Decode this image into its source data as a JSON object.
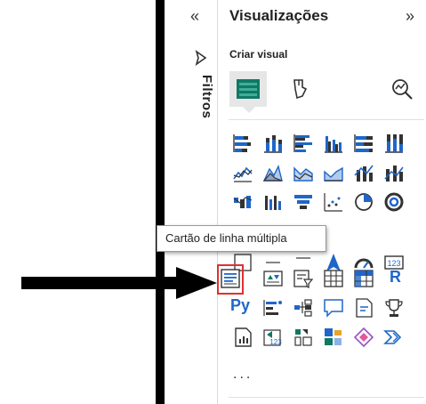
{
  "filters_pane": {
    "label": "Filtros",
    "collapse_icon": "double-chevron-left-icon",
    "filter_icon": "filter-icon"
  },
  "visualizations_pane": {
    "title": "Visualizações",
    "expand_icon": "double-chevron-right-icon",
    "section_label": "Criar visual",
    "build_tabs": [
      "visual-selected-icon",
      "format-brush-icon",
      "analytics-magnifier-icon"
    ],
    "gallery_rows": [
      [
        "stacked-bar-icon",
        "stacked-column-icon",
        "clustered-bar-icon",
        "clustered-column-icon",
        "100-stacked-bar-icon",
        "100-stacked-column-icon"
      ],
      [
        "line-chart-icon",
        "area-chart-icon",
        "stacked-area-icon",
        "line-stacked-column-icon",
        "line-clustered-column-icon",
        "ribbon-chart-icon"
      ],
      [
        "waterfall-icon",
        "funnel-icon",
        "scatter-icon",
        "pie-icon",
        "donut-icon"
      ],
      [
        "treemap-icon",
        "map-icon",
        "navigation-icon",
        "gauge-icon",
        "card-icon"
      ],
      [
        "multi-row-card-icon",
        "kpi-icon",
        "slicer-icon",
        "table-icon",
        "matrix-icon",
        "r-visual-icon"
      ],
      [
        "python-visual-icon",
        "key-influencers-icon",
        "decomposition-tree-icon",
        "qa-icon",
        "smart-narrative-icon",
        "trophy-icon"
      ],
      [
        "paginated-report-icon",
        "powerapps-icon",
        "power-automate-icon",
        "decomposition-chart-icon",
        "diamond-icon",
        "double-arrow-icon"
      ]
    ],
    "more_label": "..."
  },
  "tooltip": {
    "text": "Cartão de linha múltipla"
  },
  "colors": {
    "accent": "#117865",
    "blue": "#1f66c9",
    "highlight": "#e03030",
    "arrow": "#000000"
  }
}
